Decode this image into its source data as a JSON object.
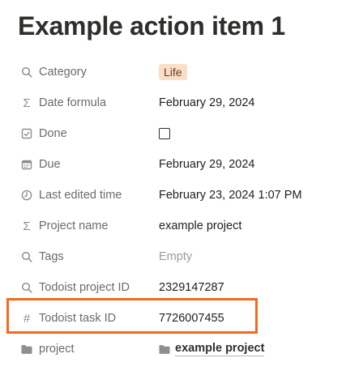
{
  "page": {
    "title": "Example action item 1"
  },
  "properties": [
    {
      "label": "Category",
      "icon": "search-icon",
      "value": "Life"
    },
    {
      "label": "Date formula",
      "icon": "sigma-icon",
      "value": "February 29, 2024"
    },
    {
      "label": "Done",
      "icon": "checkbox-icon",
      "value": "",
      "checked": false
    },
    {
      "label": "Due",
      "icon": "calendar-icon",
      "value": "February 29, 2024"
    },
    {
      "label": "Last edited time",
      "icon": "clock-icon",
      "value": "February 23, 2024 1:07 PM"
    },
    {
      "label": "Project name",
      "icon": "sigma-icon",
      "value": "example project"
    },
    {
      "label": "Tags",
      "icon": "search-icon",
      "value": "Empty"
    },
    {
      "label": "Todoist project ID",
      "icon": "search-icon",
      "value": "2329147287"
    },
    {
      "label": "Todoist task ID",
      "icon": "hash-icon",
      "value": "7726007455"
    },
    {
      "label": "project",
      "icon": "folder-icon",
      "value": "example project"
    }
  ],
  "colors": {
    "highlight": "#f26b1d",
    "tag_bg": "#fbdec9"
  }
}
